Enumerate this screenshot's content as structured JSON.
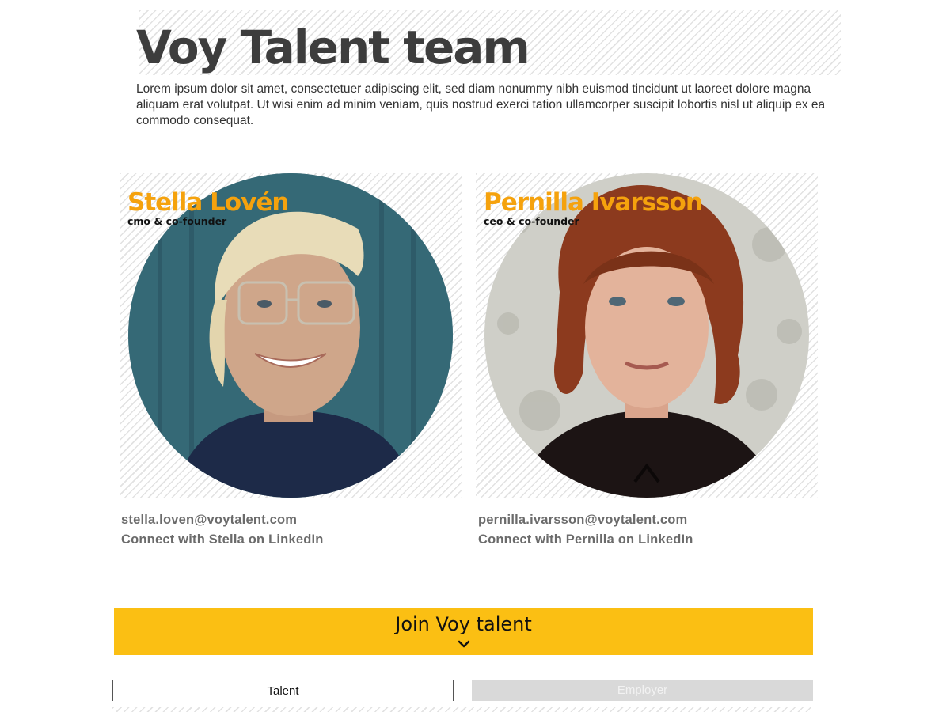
{
  "header": {
    "title": "Voy Talent team",
    "intro": "Lorem ipsum dolor sit amet, consectetuer adipiscing elit, sed diam nonummy nibh euismod tincidunt ut laoreet dolore magna aliquam erat volutpat. Ut wisi enim ad minim veniam, quis nostrud exerci tation ullamcorper suscipit lobortis nisl ut aliquip ex ea commodo consequat."
  },
  "team": [
    {
      "name": "Stella Lovén",
      "role": "cmo & co-founder",
      "email": "stella.loven@voytalent.com",
      "linkedin": "Connect with Stella on LinkedIn"
    },
    {
      "name": "Pernilla Ivarsson",
      "role": "ceo & co-founder",
      "email": "pernilla.ivarsson@voytalent.com",
      "linkedin": "Connect with Pernilla on LinkedIn"
    }
  ],
  "join": {
    "label": "Join Voy talent",
    "icon": "chevron-down-icon"
  },
  "tabs": [
    {
      "label": "Talent",
      "active": true
    },
    {
      "label": "Employer",
      "active": false
    }
  ],
  "colors": {
    "accent": "#fbbf13",
    "name": "#f5a20d",
    "title": "#3d3d3d",
    "muted": "#6b6b6b"
  }
}
